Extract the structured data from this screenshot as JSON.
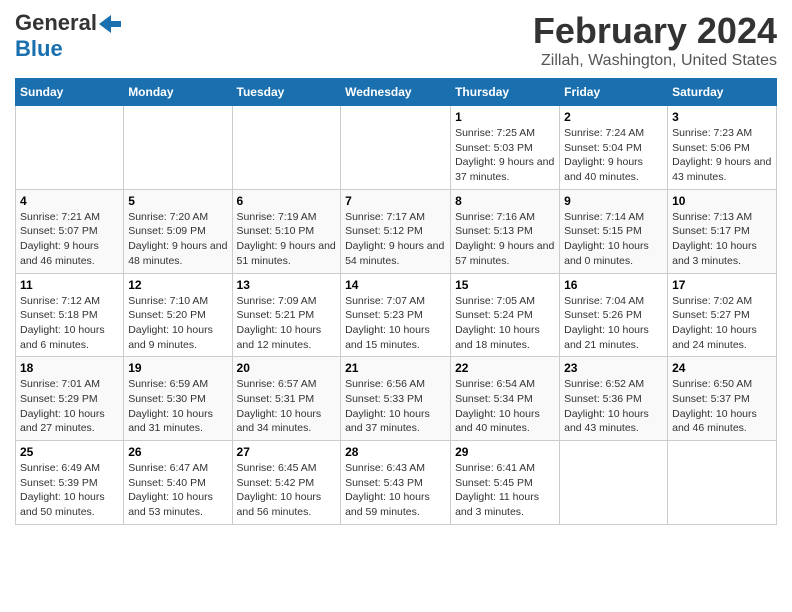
{
  "header": {
    "logo_line1": "General",
    "logo_line2": "Blue",
    "title": "February 2024",
    "subtitle": "Zillah, Washington, United States"
  },
  "days_of_week": [
    "Sunday",
    "Monday",
    "Tuesday",
    "Wednesday",
    "Thursday",
    "Friday",
    "Saturday"
  ],
  "weeks": [
    [
      {
        "day": "",
        "content": ""
      },
      {
        "day": "",
        "content": ""
      },
      {
        "day": "",
        "content": ""
      },
      {
        "day": "",
        "content": ""
      },
      {
        "day": "1",
        "content": "Sunrise: 7:25 AM\nSunset: 5:03 PM\nDaylight: 9 hours and 37 minutes."
      },
      {
        "day": "2",
        "content": "Sunrise: 7:24 AM\nSunset: 5:04 PM\nDaylight: 9 hours and 40 minutes."
      },
      {
        "day": "3",
        "content": "Sunrise: 7:23 AM\nSunset: 5:06 PM\nDaylight: 9 hours and 43 minutes."
      }
    ],
    [
      {
        "day": "4",
        "content": "Sunrise: 7:21 AM\nSunset: 5:07 PM\nDaylight: 9 hours and 46 minutes."
      },
      {
        "day": "5",
        "content": "Sunrise: 7:20 AM\nSunset: 5:09 PM\nDaylight: 9 hours and 48 minutes."
      },
      {
        "day": "6",
        "content": "Sunrise: 7:19 AM\nSunset: 5:10 PM\nDaylight: 9 hours and 51 minutes."
      },
      {
        "day": "7",
        "content": "Sunrise: 7:17 AM\nSunset: 5:12 PM\nDaylight: 9 hours and 54 minutes."
      },
      {
        "day": "8",
        "content": "Sunrise: 7:16 AM\nSunset: 5:13 PM\nDaylight: 9 hours and 57 minutes."
      },
      {
        "day": "9",
        "content": "Sunrise: 7:14 AM\nSunset: 5:15 PM\nDaylight: 10 hours and 0 minutes."
      },
      {
        "day": "10",
        "content": "Sunrise: 7:13 AM\nSunset: 5:17 PM\nDaylight: 10 hours and 3 minutes."
      }
    ],
    [
      {
        "day": "11",
        "content": "Sunrise: 7:12 AM\nSunset: 5:18 PM\nDaylight: 10 hours and 6 minutes."
      },
      {
        "day": "12",
        "content": "Sunrise: 7:10 AM\nSunset: 5:20 PM\nDaylight: 10 hours and 9 minutes."
      },
      {
        "day": "13",
        "content": "Sunrise: 7:09 AM\nSunset: 5:21 PM\nDaylight: 10 hours and 12 minutes."
      },
      {
        "day": "14",
        "content": "Sunrise: 7:07 AM\nSunset: 5:23 PM\nDaylight: 10 hours and 15 minutes."
      },
      {
        "day": "15",
        "content": "Sunrise: 7:05 AM\nSunset: 5:24 PM\nDaylight: 10 hours and 18 minutes."
      },
      {
        "day": "16",
        "content": "Sunrise: 7:04 AM\nSunset: 5:26 PM\nDaylight: 10 hours and 21 minutes."
      },
      {
        "day": "17",
        "content": "Sunrise: 7:02 AM\nSunset: 5:27 PM\nDaylight: 10 hours and 24 minutes."
      }
    ],
    [
      {
        "day": "18",
        "content": "Sunrise: 7:01 AM\nSunset: 5:29 PM\nDaylight: 10 hours and 27 minutes."
      },
      {
        "day": "19",
        "content": "Sunrise: 6:59 AM\nSunset: 5:30 PM\nDaylight: 10 hours and 31 minutes."
      },
      {
        "day": "20",
        "content": "Sunrise: 6:57 AM\nSunset: 5:31 PM\nDaylight: 10 hours and 34 minutes."
      },
      {
        "day": "21",
        "content": "Sunrise: 6:56 AM\nSunset: 5:33 PM\nDaylight: 10 hours and 37 minutes."
      },
      {
        "day": "22",
        "content": "Sunrise: 6:54 AM\nSunset: 5:34 PM\nDaylight: 10 hours and 40 minutes."
      },
      {
        "day": "23",
        "content": "Sunrise: 6:52 AM\nSunset: 5:36 PM\nDaylight: 10 hours and 43 minutes."
      },
      {
        "day": "24",
        "content": "Sunrise: 6:50 AM\nSunset: 5:37 PM\nDaylight: 10 hours and 46 minutes."
      }
    ],
    [
      {
        "day": "25",
        "content": "Sunrise: 6:49 AM\nSunset: 5:39 PM\nDaylight: 10 hours and 50 minutes."
      },
      {
        "day": "26",
        "content": "Sunrise: 6:47 AM\nSunset: 5:40 PM\nDaylight: 10 hours and 53 minutes."
      },
      {
        "day": "27",
        "content": "Sunrise: 6:45 AM\nSunset: 5:42 PM\nDaylight: 10 hours and 56 minutes."
      },
      {
        "day": "28",
        "content": "Sunrise: 6:43 AM\nSunset: 5:43 PM\nDaylight: 10 hours and 59 minutes."
      },
      {
        "day": "29",
        "content": "Sunrise: 6:41 AM\nSunset: 5:45 PM\nDaylight: 11 hours and 3 minutes."
      },
      {
        "day": "",
        "content": ""
      },
      {
        "day": "",
        "content": ""
      }
    ]
  ]
}
